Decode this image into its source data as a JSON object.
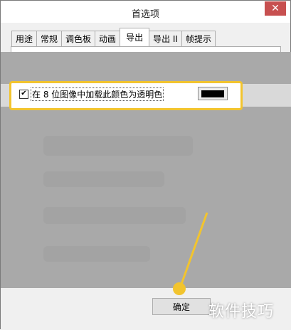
{
  "window": {
    "title": "首选项",
    "close_glyph": "✕"
  },
  "tabs": [
    {
      "label": "用途",
      "active": false
    },
    {
      "label": "常规",
      "active": false
    },
    {
      "label": "调色板",
      "active": false
    },
    {
      "label": "动画",
      "active": false
    },
    {
      "label": "导出",
      "active": true
    },
    {
      "label": "导出 II",
      "active": false
    },
    {
      "label": "帧提示",
      "active": false
    }
  ],
  "option": {
    "checked": true,
    "check_glyph": "✔",
    "label": "在 8 位图像中加载此颜色为透明色",
    "color_value": "#000000"
  },
  "buttons": {
    "ok_label": "确定"
  },
  "watermark": {
    "text": "软件技巧"
  },
  "colors": {
    "highlight": "#f2c42e",
    "close_button": "#c75050",
    "blur": "#a9a9a9"
  }
}
